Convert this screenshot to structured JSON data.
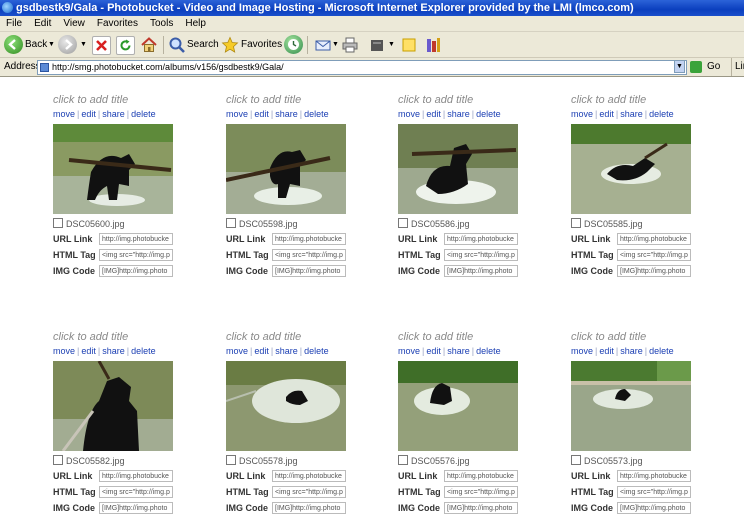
{
  "window": {
    "title": "gsdbestk9/Gala - Photobucket - Video and Image Hosting - Microsoft Internet Explorer provided by the LMI (lmco.com)"
  },
  "menu": [
    "File",
    "Edit",
    "View",
    "Favorites",
    "Tools",
    "Help"
  ],
  "toolbar": {
    "back_label": "Back",
    "search_label": "Search",
    "favorites_label": "Favorites"
  },
  "address": {
    "label": "Address",
    "url": "http://smg.photobucket.com/albums/v156/gsdbestk9/Gala/",
    "go_label": "Go",
    "links_label": "Lin"
  },
  "labels": {
    "click_to_add_title": "click to add title",
    "move": "move",
    "edit": "edit",
    "share": "share",
    "delete": "delete",
    "url_link": "URL Link",
    "html_tag": "HTML Tag",
    "img_code": "IMG Code"
  },
  "photos": [
    {
      "filename": "DSC05600.jpg",
      "url": "http://img.photobucke",
      "html": "<img src=\"http://img.p",
      "img": "[IMG]http://img.photo"
    },
    {
      "filename": "DSC05598.jpg",
      "url": "http://img.photobucke",
      "html": "<img src=\"http://img.p",
      "img": "[IMG]http://img.photo"
    },
    {
      "filename": "DSC05586.jpg",
      "url": "http://img.photobucke",
      "html": "<img src=\"http://img.p",
      "img": "[IMG]http://img.photo"
    },
    {
      "filename": "DSC05585.jpg",
      "url": "http://img.photobucke",
      "html": "<img src=\"http://img.p",
      "img": "[IMG]http://img.photo"
    },
    {
      "filename": "DSC05582.jpg",
      "url": "http://img.photobucke",
      "html": "<img src=\"http://img.p",
      "img": "[IMG]http://img.photo"
    },
    {
      "filename": "DSC05578.jpg",
      "url": "http://img.photobucke",
      "html": "<img src=\"http://img.p",
      "img": "[IMG]http://img.photo"
    },
    {
      "filename": "DSC05576.jpg",
      "url": "http://img.photobucke",
      "html": "<img src=\"http://img.p",
      "img": "[IMG]http://img.photo"
    },
    {
      "filename": "DSC05573.jpg",
      "url": "http://img.photobucke",
      "html": "<img src=\"http://img.p",
      "img": "[IMG]http://img.photo"
    }
  ],
  "colors": {
    "titlebar": "#0b3fbe",
    "chrome": "#ece9d8",
    "link": "#1b3fb3"
  },
  "icons": [
    "ie-logo-icon",
    "back-arrow-icon",
    "forward-arrow-icon",
    "stop-icon",
    "refresh-icon",
    "home-icon",
    "search-icon",
    "favorites-star-icon",
    "history-icon",
    "mail-icon",
    "print-icon",
    "edit-page-icon",
    "messenger-icon",
    "research-icon",
    "page-icon"
  ]
}
